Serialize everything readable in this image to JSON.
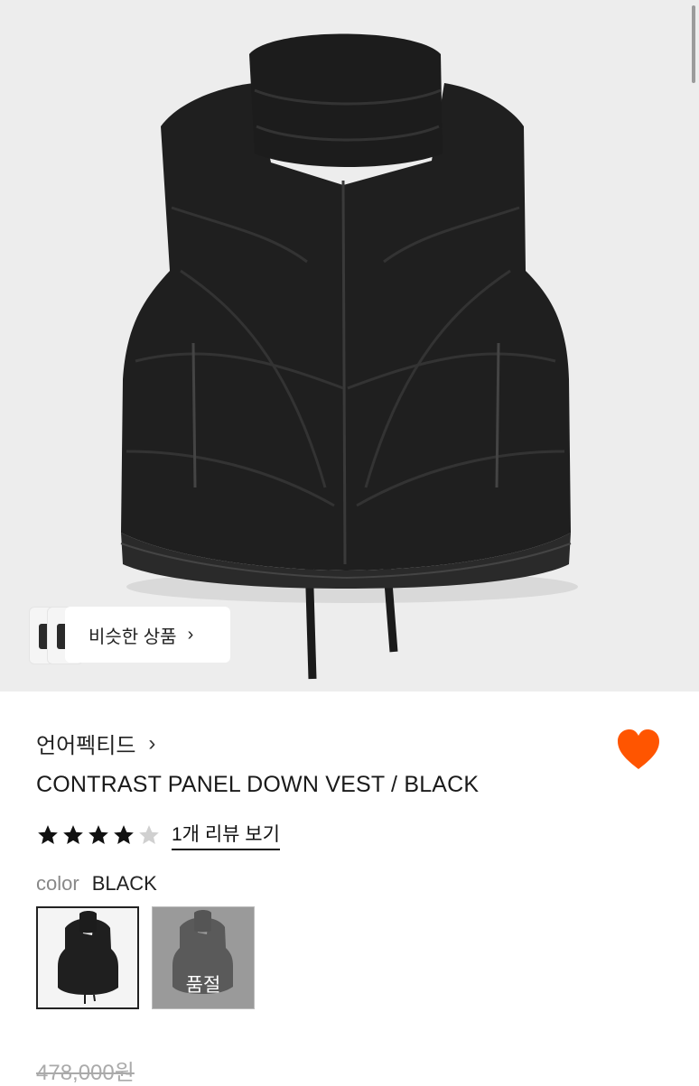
{
  "similar_products": {
    "label": "비슷한 상품",
    "arrow": "›"
  },
  "brand": {
    "name": "언어펙티드",
    "arrow": "›"
  },
  "wishlist": {
    "icon": "heart-icon",
    "color": "#ff5500"
  },
  "product": {
    "title": "CONTRAST PANEL DOWN VEST / BLACK"
  },
  "rating": {
    "stars": 4,
    "max": 5,
    "review_link": "1개 리뷰 보기"
  },
  "color_option": {
    "label": "color",
    "value": "BLACK",
    "swatches": [
      {
        "name": "BLACK",
        "selected": true
      },
      {
        "name": "GREY",
        "status": "품절"
      }
    ]
  },
  "price": {
    "original": "478,000원"
  }
}
